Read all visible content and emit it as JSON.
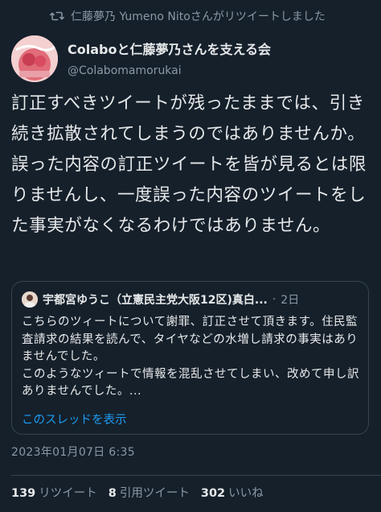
{
  "retweet": {
    "icon": "retweet-icon",
    "text": "仁藤夢乃 Yumeno Nitoさんがリツイートしました"
  },
  "author": {
    "avatar_icon": "avatar-colabo",
    "avatar_text": "Colabo",
    "display_name": "Colaboと仁藤夢乃さんを支える会",
    "handle": "@Colabomamorukai"
  },
  "tweet": {
    "text": "訂正すべきツイートが残ったままでは、引き続き拡散されてしまうのではありませんか。誤った内容の訂正ツイートを皆が見るとは限りませんし、一度誤った内容のツイートをした事実がなくなるわけではありません。"
  },
  "quote": {
    "author": "宇都宮ゆうこ（立憲民主党大阪12区)真白...",
    "dot": "·",
    "time": "2日",
    "text": "こちらのツィートについて謝罪、訂正させて頂きます。住民監査請求の結果を読んで、タイヤなどの水増し請求の事実はありませんでした。\nこのようなツィートで情報を混乱させてしまい、改めて申し訳ありませんでした。...",
    "show_thread": "このスレッドを表示"
  },
  "timestamp": "2023年01月07日 6:35",
  "stats": [
    {
      "num": "139",
      "label": "リツイート"
    },
    {
      "num": "8",
      "label": "引用ツイート"
    },
    {
      "num": "302",
      "label": "いいね"
    }
  ],
  "colors": {
    "background": "#15202b",
    "text": "#e7e9ea",
    "secondary": "#8b98a5",
    "link": "#1d9bf0",
    "border": "#38444d"
  }
}
